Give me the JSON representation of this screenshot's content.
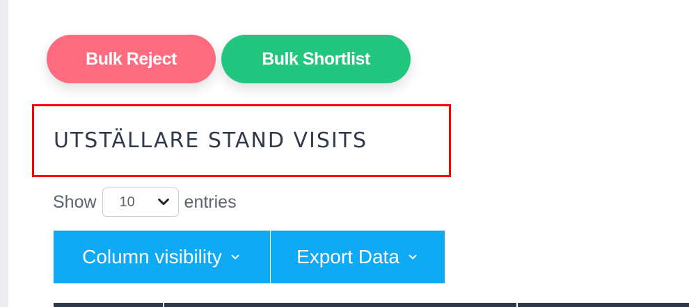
{
  "bulk_actions": {
    "reject_label": "Bulk Reject",
    "shortlist_label": "Bulk Shortlist",
    "reject_color": "#ff6b7f",
    "shortlist_color": "#23c67f"
  },
  "section": {
    "title": "UTSTÄLLARE STAND VISITS",
    "highlight_color": "#ff0000"
  },
  "length_menu": {
    "show_label": "Show",
    "selected_value": "10",
    "entries_label": "entries"
  },
  "toolbar": {
    "column_visibility_label": "Column visibility",
    "export_label": "Export Data",
    "button_color": "#0eaaf5"
  },
  "table": {
    "header_color": "#2d3a4b"
  }
}
